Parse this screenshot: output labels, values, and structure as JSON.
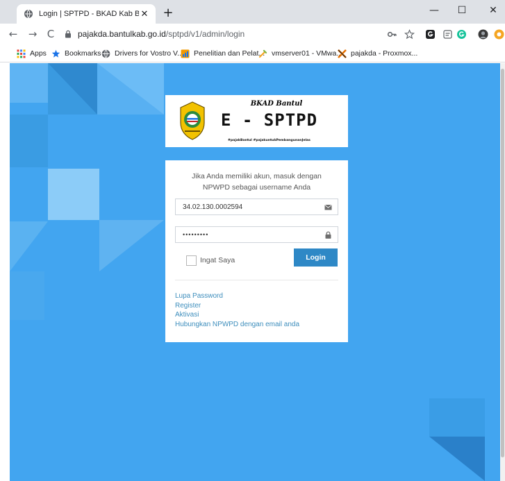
{
  "browser": {
    "tab_title": "Login | SPTPD - BKAD Kab Bantul",
    "tab_close": "✕",
    "new_tab": "+",
    "window_minimize": "—",
    "window_maximize": "☐",
    "window_close": "✕",
    "nav_back": "←",
    "nav_forward": "→",
    "nav_reload": "C",
    "url_host": "pajakda.bantulkab.go.id",
    "url_path": "/sptpd/v1/admin/login",
    "bookmarks": [
      {
        "label": "Apps",
        "icon": "apps-grid-icon"
      },
      {
        "label": "Bookmarks",
        "icon": "star-icon"
      },
      {
        "label": "Drivers for Vostro V...",
        "icon": "globe-icon"
      },
      {
        "label": "Penelitian dan Pelat...",
        "icon": "site-favicon-icon"
      },
      {
        "label": "vmserver01 - VMwa...",
        "icon": "vmware-icon"
      },
      {
        "label": "pajakda - Proxmox...",
        "icon": "proxmox-icon"
      }
    ]
  },
  "logo": {
    "agency": "BKAD Bantul",
    "app_name": "E - SPTPD",
    "hashtags": "#pajakBantul    #pajakuntukPembangunanJelas"
  },
  "login": {
    "intro": "Jika Anda memiliki akun, masuk dengan NPWPD sebagai username Anda",
    "username_value": "34.02.130.0002594",
    "password_value": "•••••••••",
    "remember_label": "Ingat Saya",
    "login_button": "Login"
  },
  "links": [
    "Lupa Password",
    "Register",
    "Aktivasi",
    "Hubungkan NPWPD dengan email anda"
  ],
  "colors": {
    "page_background": "#42a5f0",
    "primary_button": "#2e88c6",
    "link": "#3c8dbc"
  }
}
